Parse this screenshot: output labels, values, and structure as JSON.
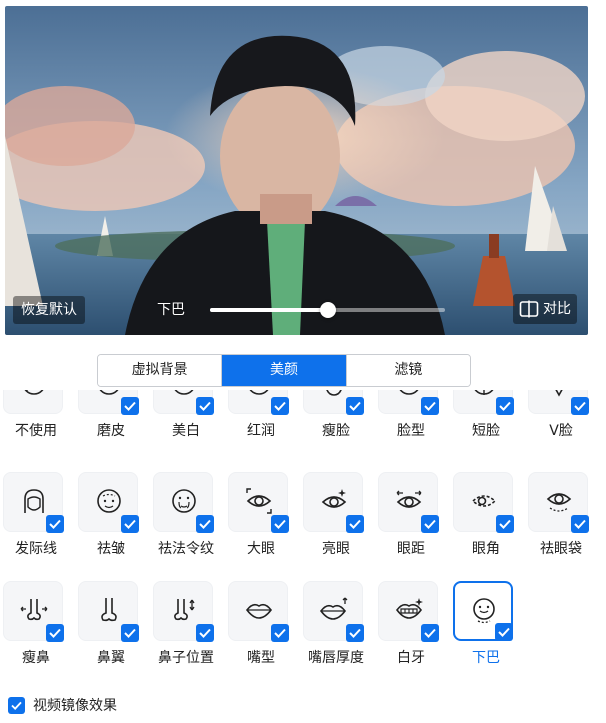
{
  "preview": {
    "reset_label": "恢复默认",
    "slider_label": "下巴",
    "slider_level": 0.5,
    "compare_label": "对比"
  },
  "tabs": [
    {
      "label": "虚拟背景",
      "active": false
    },
    {
      "label": "美颜",
      "active": true
    },
    {
      "label": "滤镜",
      "active": false
    }
  ],
  "effects": {
    "row1": [
      "不使用",
      "磨皮",
      "美白",
      "红润",
      "瘦脸",
      "脸型",
      "短脸",
      "V脸"
    ],
    "row2": [
      "发际线",
      "祛皱",
      "祛法令纹",
      "大眼",
      "亮眼",
      "眼距",
      "眼角",
      "祛眼袋"
    ],
    "row3": [
      "瘦鼻",
      "鼻翼",
      "鼻子位置",
      "嘴型",
      "嘴唇厚度",
      "白牙",
      "下巴"
    ],
    "selected": "下巴"
  },
  "mirror": {
    "label": "视频镜像效果",
    "checked": true
  },
  "colors": {
    "accent": "#0e71eb",
    "tile_bg": "#f5f6f8"
  }
}
